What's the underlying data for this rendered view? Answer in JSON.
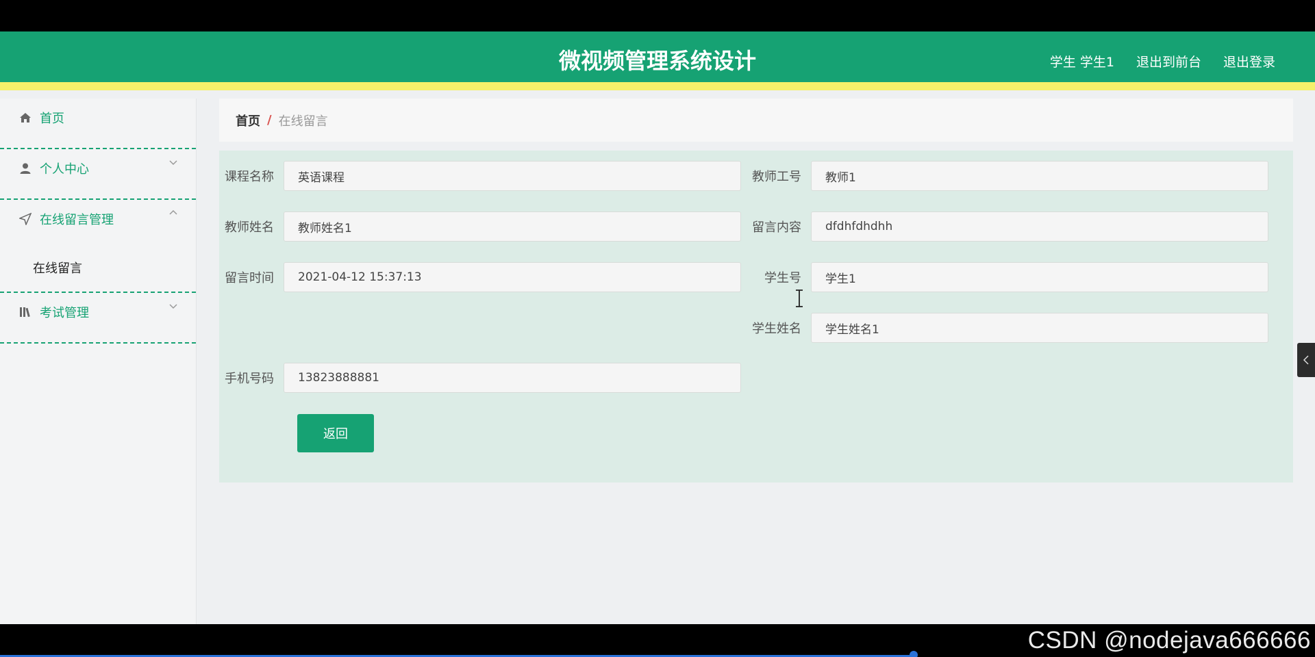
{
  "header": {
    "title": "微视频管理系统设计",
    "nav": {
      "user": "学生 学生1",
      "to_front": "退出到前台",
      "logout": "退出登录"
    }
  },
  "sidebar": {
    "home": "首页",
    "personal_center": "个人中心",
    "message_management": "在线留言管理",
    "message_sub": "在线留言",
    "exam_management": "考试管理"
  },
  "breadcrumb": {
    "home": "首页",
    "separator": "/",
    "current": "在线留言"
  },
  "form": {
    "course_name": {
      "label": "课程名称",
      "value": "英语课程"
    },
    "teacher_id": {
      "label": "教师工号",
      "value": "教师1"
    },
    "teacher_name": {
      "label": "教师姓名",
      "value": "教师姓名1"
    },
    "message_content": {
      "label": "留言内容",
      "value": "dfdhfdhdhh"
    },
    "message_time": {
      "label": "留言时间",
      "value": "2021-04-12 15:37:13"
    },
    "student_id": {
      "label": "学生号",
      "value": "学生1"
    },
    "student_name": {
      "label": "学生姓名",
      "value": "学生姓名1"
    },
    "phone": {
      "label": "手机号码",
      "value": "13823888881"
    },
    "back_button": "返回"
  },
  "watermark": "CSDN @nodejava666666",
  "colors": {
    "primary": "#16a273",
    "accent_strip": "#f5f06a",
    "form_panel": "#dcece6"
  }
}
